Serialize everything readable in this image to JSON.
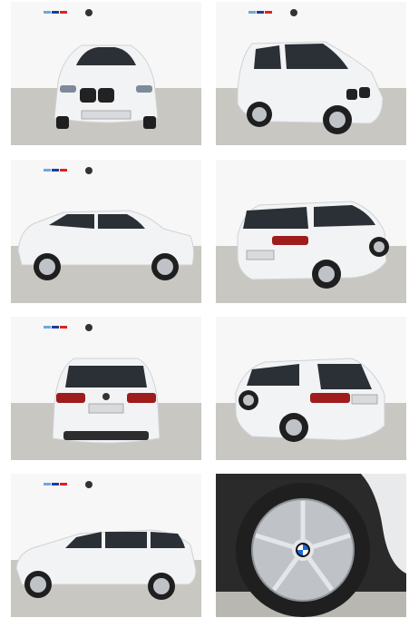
{
  "gallery": {
    "photos": [
      {
        "view": "front"
      },
      {
        "view": "front-three-quarter"
      },
      {
        "view": "side-left"
      },
      {
        "view": "rear-three-quarter-left"
      },
      {
        "view": "rear"
      },
      {
        "view": "rear-three-quarter-right"
      },
      {
        "view": "side-left-alt"
      },
      {
        "view": "wheel-closeup"
      }
    ]
  },
  "colors": {
    "car_body": "#f2f3f4",
    "showroom_wall": "#f7f7f7",
    "showroom_floor": "#c9c7c2",
    "window_tint": "#2b2f36",
    "tire": "#1f1f1f",
    "rim": "#bfc3c8",
    "taillight": "#9e1c1c",
    "bmw_blue": "#1c69d4"
  },
  "icons": [
    "bmw-logo-icon",
    "bmw-m-stripes-icon"
  ]
}
